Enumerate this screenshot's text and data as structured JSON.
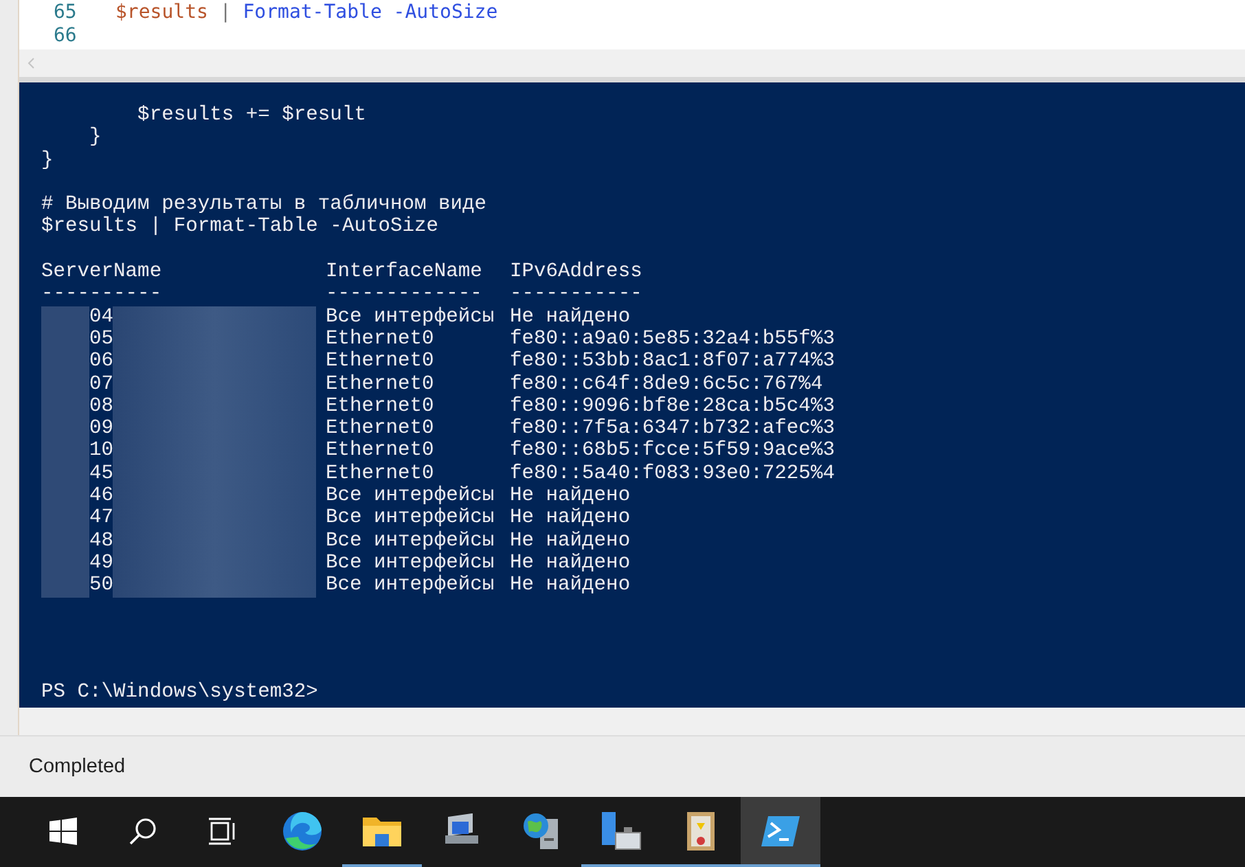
{
  "editor": {
    "lines": [
      {
        "number": "65",
        "tokens": [
          {
            "text": "$results",
            "kind": "variable"
          },
          {
            "text": " | ",
            "kind": "operator"
          },
          {
            "text": "Format-Table -AutoSize",
            "kind": "command"
          }
        ]
      },
      {
        "number": "66"
      }
    ]
  },
  "console": {
    "blocks": [
      [
        "        $results += $result",
        "    }",
        "}"
      ],
      [
        "# Выводим результаты в табличном виде",
        "$results | Format-Table -AutoSize"
      ]
    ],
    "table": {
      "columns": [
        "ServerName",
        "InterfaceName",
        "IPv6Address"
      ],
      "underlines": [
        "----------",
        "-------------",
        "-----------"
      ],
      "rows": [
        {
          "server": "04",
          "interface": "Все интерфейсы",
          "address": "Не найдено"
        },
        {
          "server": "05",
          "interface": "Ethernet0",
          "address": "fe80::a9a0:5e85:32a4:b55f%3"
        },
        {
          "server": "06",
          "interface": "Ethernet0",
          "address": "fe80::53bb:8ac1:8f07:a774%3"
        },
        {
          "server": "07",
          "interface": "Ethernet0",
          "address": "fe80::c64f:8de9:6c5c:767%4"
        },
        {
          "server": "08",
          "interface": "Ethernet0",
          "address": "fe80::9096:bf8e:28ca:b5c4%3"
        },
        {
          "server": "09",
          "interface": "Ethernet0",
          "address": "fe80::7f5a:6347:b732:afec%3"
        },
        {
          "server": "10",
          "interface": "Ethernet0",
          "address": "fe80::68b5:fcce:5f59:9ace%3"
        },
        {
          "server": "45",
          "interface": "Ethernet0",
          "address": "fe80::5a40:f083:93e0:7225%4"
        },
        {
          "server": "46",
          "interface": "Все интерфейсы",
          "address": "Не найдено"
        },
        {
          "server": "47",
          "interface": "Все интерфейсы",
          "address": "Не найдено"
        },
        {
          "server": "48",
          "interface": "Все интерфейсы",
          "address": "Не найдено"
        },
        {
          "server": "49",
          "interface": "Все интерфейсы",
          "address": "Не найдено"
        },
        {
          "server": "50",
          "interface": "Все интерфейсы",
          "address": "Не найдено"
        }
      ]
    },
    "prompt": "PS C:\\Windows\\system32>"
  },
  "status_bar": {
    "text": "Completed"
  },
  "taskbar": {
    "items": [
      {
        "kind": "start",
        "running": false,
        "selected": false
      },
      {
        "kind": "search",
        "running": false,
        "selected": false
      },
      {
        "kind": "taskview",
        "running": false,
        "selected": false
      },
      {
        "kind": "browser",
        "running": false,
        "selected": false
      },
      {
        "kind": "folder",
        "running": true,
        "selected": false
      },
      {
        "kind": "monitor",
        "running": false,
        "selected": false
      },
      {
        "kind": "globe",
        "running": false,
        "selected": false
      },
      {
        "kind": "server",
        "running": true,
        "selected": false
      },
      {
        "kind": "document",
        "running": true,
        "selected": false
      },
      {
        "kind": "terminal",
        "running": true,
        "selected": true
      }
    ]
  }
}
